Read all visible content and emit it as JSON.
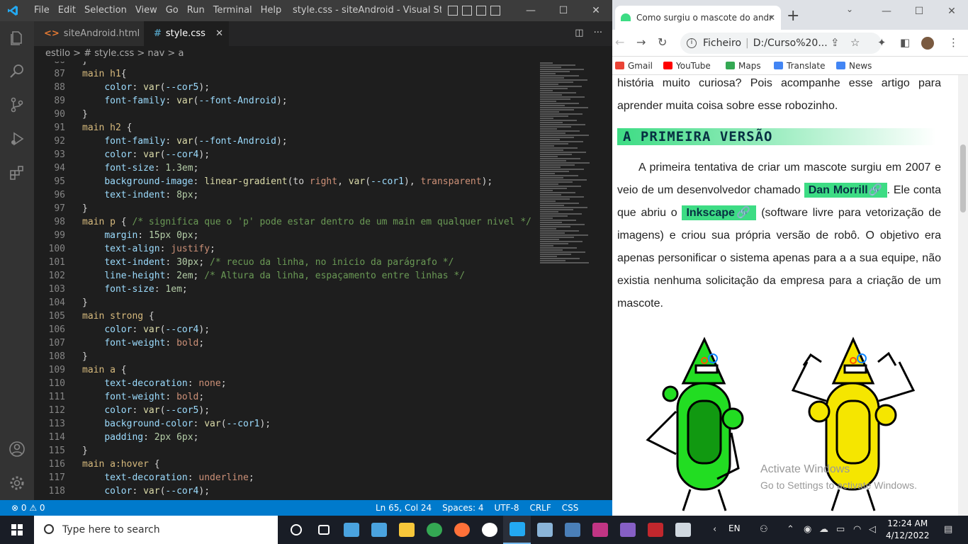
{
  "vscode": {
    "menu": [
      "File",
      "Edit",
      "Selection",
      "View",
      "Go",
      "Run",
      "Terminal",
      "Help"
    ],
    "window_title": "style.css - siteAndroid - Visual Studio ...",
    "tabs": [
      {
        "icon": "<>",
        "label": "siteAndroid.html"
      },
      {
        "icon": "#",
        "label": "style.css"
      }
    ],
    "breadcrumb": "estilo > # style.css > nav > a",
    "code_lines": [
      {
        "n": "86",
        "t": [
          [
            "pn",
            "}"
          ]
        ]
      },
      {
        "n": "87",
        "t": [
          [
            "sel",
            "main h1"
          ],
          [
            "pn",
            "{"
          ]
        ]
      },
      {
        "n": "88",
        "t": [
          [
            "pn",
            "    "
          ],
          [
            "prop",
            "color"
          ],
          [
            "pn",
            ": "
          ],
          [
            "fn",
            "var"
          ],
          [
            "pn",
            "("
          ],
          [
            "prop",
            "--cor5"
          ],
          [
            "pn",
            ");"
          ]
        ]
      },
      {
        "n": "89",
        "t": [
          [
            "pn",
            "    "
          ],
          [
            "prop",
            "font-family"
          ],
          [
            "pn",
            ": "
          ],
          [
            "fn",
            "var"
          ],
          [
            "pn",
            "("
          ],
          [
            "prop",
            "--font-Android"
          ],
          [
            "pn",
            ");"
          ]
        ]
      },
      {
        "n": "90",
        "t": [
          [
            "pn",
            "}"
          ]
        ]
      },
      {
        "n": "91",
        "t": [
          [
            "sel",
            "main h2"
          ],
          [
            "pn",
            " {"
          ]
        ]
      },
      {
        "n": "92",
        "t": [
          [
            "pn",
            "    "
          ],
          [
            "prop",
            "font-family"
          ],
          [
            "pn",
            ": "
          ],
          [
            "fn",
            "var"
          ],
          [
            "pn",
            "("
          ],
          [
            "prop",
            "--font-Android"
          ],
          [
            "pn",
            ");"
          ]
        ]
      },
      {
        "n": "93",
        "t": [
          [
            "pn",
            "    "
          ],
          [
            "prop",
            "color"
          ],
          [
            "pn",
            ": "
          ],
          [
            "fn",
            "var"
          ],
          [
            "pn",
            "("
          ],
          [
            "prop",
            "--cor4"
          ],
          [
            "pn",
            ");"
          ]
        ]
      },
      {
        "n": "94",
        "t": [
          [
            "pn",
            "    "
          ],
          [
            "prop",
            "font-size"
          ],
          [
            "pn",
            ": "
          ],
          [
            "num",
            "1.3em"
          ],
          [
            "pn",
            ";"
          ]
        ]
      },
      {
        "n": "95",
        "t": [
          [
            "pn",
            "    "
          ],
          [
            "prop",
            "background-image"
          ],
          [
            "pn",
            ": "
          ],
          [
            "fn",
            "linear-gradient"
          ],
          [
            "pn",
            "(to "
          ],
          [
            "val",
            "right"
          ],
          [
            "pn",
            ", "
          ],
          [
            "fn",
            "var"
          ],
          [
            "pn",
            "("
          ],
          [
            "prop",
            "--cor1"
          ],
          [
            "pn",
            "), "
          ],
          [
            "val",
            "transparent"
          ],
          [
            "pn",
            ");"
          ]
        ]
      },
      {
        "n": "96",
        "t": [
          [
            "pn",
            "    "
          ],
          [
            "prop",
            "text-indent"
          ],
          [
            "pn",
            ": "
          ],
          [
            "num",
            "8px"
          ],
          [
            "pn",
            ";"
          ]
        ]
      },
      {
        "n": "97",
        "t": [
          [
            "pn",
            "}"
          ]
        ]
      },
      {
        "n": "98",
        "t": [
          [
            "sel",
            "main p"
          ],
          [
            "pn",
            " { "
          ],
          [
            "cmt",
            "/* significa que o 'p' pode estar dentro de um main em qualquer nivel */"
          ]
        ]
      },
      {
        "n": "99",
        "t": [
          [
            "pn",
            "    "
          ],
          [
            "prop",
            "margin"
          ],
          [
            "pn",
            ": "
          ],
          [
            "num",
            "15px 0px"
          ],
          [
            "pn",
            ";"
          ]
        ]
      },
      {
        "n": "100",
        "t": [
          [
            "pn",
            "    "
          ],
          [
            "prop",
            "text-align"
          ],
          [
            "pn",
            ": "
          ],
          [
            "val",
            "justify"
          ],
          [
            "pn",
            ";"
          ]
        ]
      },
      {
        "n": "101",
        "t": [
          [
            "pn",
            "    "
          ],
          [
            "prop",
            "text-indent"
          ],
          [
            "pn",
            ": "
          ],
          [
            "num",
            "30px"
          ],
          [
            "pn",
            "; "
          ],
          [
            "cmt",
            "/* recuo da linha, no inicio da parágrafo */"
          ]
        ]
      },
      {
        "n": "102",
        "t": [
          [
            "pn",
            "    "
          ],
          [
            "prop",
            "line-height"
          ],
          [
            "pn",
            ": "
          ],
          [
            "num",
            "2em"
          ],
          [
            "pn",
            "; "
          ],
          [
            "cmt",
            "/* Altura da linha, espaçamento entre linhas */"
          ]
        ]
      },
      {
        "n": "103",
        "t": [
          [
            "pn",
            "    "
          ],
          [
            "prop",
            "font-size"
          ],
          [
            "pn",
            ": "
          ],
          [
            "num",
            "1em"
          ],
          [
            "pn",
            ";"
          ]
        ]
      },
      {
        "n": "104",
        "t": [
          [
            "pn",
            "}"
          ]
        ]
      },
      {
        "n": "105",
        "t": [
          [
            "sel",
            "main strong"
          ],
          [
            "pn",
            " {"
          ]
        ]
      },
      {
        "n": "106",
        "t": [
          [
            "pn",
            "    "
          ],
          [
            "prop",
            "color"
          ],
          [
            "pn",
            ": "
          ],
          [
            "fn",
            "var"
          ],
          [
            "pn",
            "("
          ],
          [
            "prop",
            "--cor4"
          ],
          [
            "pn",
            ");"
          ]
        ]
      },
      {
        "n": "107",
        "t": [
          [
            "pn",
            "    "
          ],
          [
            "prop",
            "font-weight"
          ],
          [
            "pn",
            ": "
          ],
          [
            "val",
            "bold"
          ],
          [
            "pn",
            ";"
          ]
        ]
      },
      {
        "n": "108",
        "t": [
          [
            "pn",
            "}"
          ]
        ]
      },
      {
        "n": "109",
        "t": [
          [
            "sel",
            "main a"
          ],
          [
            "pn",
            " {"
          ]
        ]
      },
      {
        "n": "110",
        "t": [
          [
            "pn",
            "    "
          ],
          [
            "prop",
            "text-decoration"
          ],
          [
            "pn",
            ": "
          ],
          [
            "val",
            "none"
          ],
          [
            "pn",
            ";"
          ]
        ]
      },
      {
        "n": "111",
        "t": [
          [
            "pn",
            "    "
          ],
          [
            "prop",
            "font-weight"
          ],
          [
            "pn",
            ": "
          ],
          [
            "val",
            "bold"
          ],
          [
            "pn",
            ";"
          ]
        ]
      },
      {
        "n": "112",
        "t": [
          [
            "pn",
            "    "
          ],
          [
            "prop",
            "color"
          ],
          [
            "pn",
            ": "
          ],
          [
            "fn",
            "var"
          ],
          [
            "pn",
            "("
          ],
          [
            "prop",
            "--cor5"
          ],
          [
            "pn",
            ");"
          ]
        ]
      },
      {
        "n": "113",
        "t": [
          [
            "pn",
            "    "
          ],
          [
            "prop",
            "background-color"
          ],
          [
            "pn",
            ": "
          ],
          [
            "fn",
            "var"
          ],
          [
            "pn",
            "("
          ],
          [
            "prop",
            "--cor1"
          ],
          [
            "pn",
            ");"
          ]
        ]
      },
      {
        "n": "114",
        "t": [
          [
            "pn",
            "    "
          ],
          [
            "prop",
            "padding"
          ],
          [
            "pn",
            ": "
          ],
          [
            "num",
            "2px 6px"
          ],
          [
            "pn",
            ";"
          ]
        ]
      },
      {
        "n": "115",
        "t": [
          [
            "pn",
            "}"
          ]
        ]
      },
      {
        "n": "116",
        "t": [
          [
            "sel",
            "main a:hover"
          ],
          [
            "pn",
            " {"
          ]
        ]
      },
      {
        "n": "117",
        "t": [
          [
            "pn",
            "    "
          ],
          [
            "prop",
            "text-decoration"
          ],
          [
            "pn",
            ": "
          ],
          [
            "val",
            "underline"
          ],
          [
            "pn",
            ";"
          ]
        ]
      },
      {
        "n": "118",
        "t": [
          [
            "pn",
            "    "
          ],
          [
            "prop",
            "color"
          ],
          [
            "pn",
            ": "
          ],
          [
            "fn",
            "var"
          ],
          [
            "pn",
            "("
          ],
          [
            "prop",
            "--cor4"
          ],
          [
            "pn",
            ");"
          ]
        ]
      }
    ],
    "status": {
      "problems": "⊗ 0 ⚠ 0",
      "right": [
        "Ln 65, Col 24",
        "Spaces: 4",
        "UTF-8",
        "CRLF",
        "CSS"
      ]
    },
    "colors": {
      "accent": "#007acc",
      "bg": "#1e1e1e"
    }
  },
  "chrome": {
    "tab_title": "Como surgiu o mascote do andr",
    "omnibox_label": "Ficheiro",
    "omnibox_url": "D:/Curso%20...",
    "bookmarks": [
      {
        "label": "Gmail",
        "color": "#ea4335"
      },
      {
        "label": "YouTube",
        "color": "#ff0000"
      },
      {
        "label": "Maps",
        "color": "#34a853"
      },
      {
        "label": "Translate",
        "color": "#4285f4"
      },
      {
        "label": "News",
        "color": "#4285f4"
      }
    ],
    "page": {
      "p1": "história muito curiosa? Pois acompanhe esse artigo para aprender muita coisa sobre esse robozinho.",
      "h2": "A PRIMEIRA VERSÃO",
      "p2_a": "A primeira tentativa de criar um mascote surgiu em 2007 e veio de um desenvolvedor chamado ",
      "link1": "Dan Morrill🔗",
      "p2_b": ". Ele conta que abriu o ",
      "link2": "Inkscape🔗",
      "p2_c": " (software livre para vetorização de imagens) e criou sua própria versão de robô. O objetivo era apenas personificar o sistema apenas para a a sua equipe, não existia nenhuma solicitação da empresa para a criação de um mascote.",
      "activate_title": "Activate Windows",
      "activate_sub": "Go to Settings to activate Windows.",
      "colors": {
        "green": "#3ddc84",
        "dark": "#073042",
        "yellow": "#f5e600"
      }
    }
  },
  "taskbar": {
    "search_placeholder": "Type here to search",
    "lang": "EN",
    "time": "12:24 AM",
    "date": "4/12/2022",
    "apps": [
      {
        "name": "cortana",
        "color": "#ffffff"
      },
      {
        "name": "task-view",
        "color": "#ffffff"
      },
      {
        "name": "news",
        "color": "#4aa3df"
      },
      {
        "name": "this-pc",
        "color": "#4aa3df"
      },
      {
        "name": "file-explorer",
        "color": "#f8c73a"
      },
      {
        "name": "chrome",
        "color": "#34a853"
      },
      {
        "name": "firefox",
        "color": "#ff7139"
      },
      {
        "name": "github",
        "color": "#ffffff"
      },
      {
        "name": "vscode",
        "color": "#23a9f2"
      },
      {
        "name": "virtualbox",
        "color": "#8ab4d8"
      },
      {
        "name": "app-a",
        "color": "#4a7fb8"
      },
      {
        "name": "app-w",
        "color": "#c13584"
      },
      {
        "name": "visual-studio",
        "color": "#865fc5"
      },
      {
        "name": "access",
        "color": "#c1272d"
      },
      {
        "name": "paint",
        "color": "#d0d8e0"
      }
    ]
  }
}
